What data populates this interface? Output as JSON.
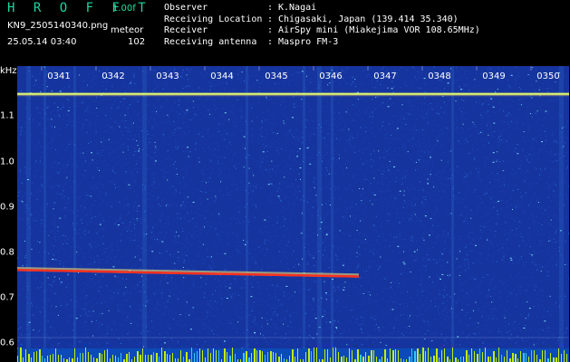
{
  "header": {
    "brand": "H R O F F T",
    "version": "1.00f",
    "filename": "KN9_2505140340.png",
    "timestamp": "25.05.14 03:40",
    "meteor_label": "meteor",
    "meteor_count": "102",
    "info": [
      {
        "label": "Observer",
        "sep": ":",
        "value": "K.Nagai"
      },
      {
        "label": "Receiving Location",
        "sep": ":",
        "value": "Chigasaki, Japan (139.414 35.340)"
      },
      {
        "label": "Receiver",
        "sep": ":",
        "value": "AirSpy mini (Miakejima VOR 108.65MHz)"
      },
      {
        "label": "Receiving antenna",
        "sep": ":",
        "value": "Maspro FM-3"
      }
    ]
  },
  "chart_data": {
    "type": "heatmap",
    "title": "",
    "xlabel": "",
    "ylabel": "kHz",
    "x_tick_labels": [
      "0341",
      "0342",
      "0343",
      "0344",
      "0345",
      "0346",
      "0347",
      "0348",
      "0349",
      "0350"
    ],
    "y_tick_labels": [
      "1.1",
      "1.0",
      "0.9",
      "0.8",
      "0.7",
      "0.6"
    ],
    "ylim": [
      0.58,
      1.165
    ],
    "persistent_line_khz": 1.11,
    "meteor_trace": {
      "start_time": "0341",
      "end_time": "0347",
      "start_khz": 0.762,
      "end_khz": 0.749
    },
    "colors": {
      "background": "#16349e",
      "noise": "#2f8fff",
      "hot": "#ff2a1a",
      "line": "#e8ff6e",
      "bottom_band": "#d8ff00"
    }
  }
}
